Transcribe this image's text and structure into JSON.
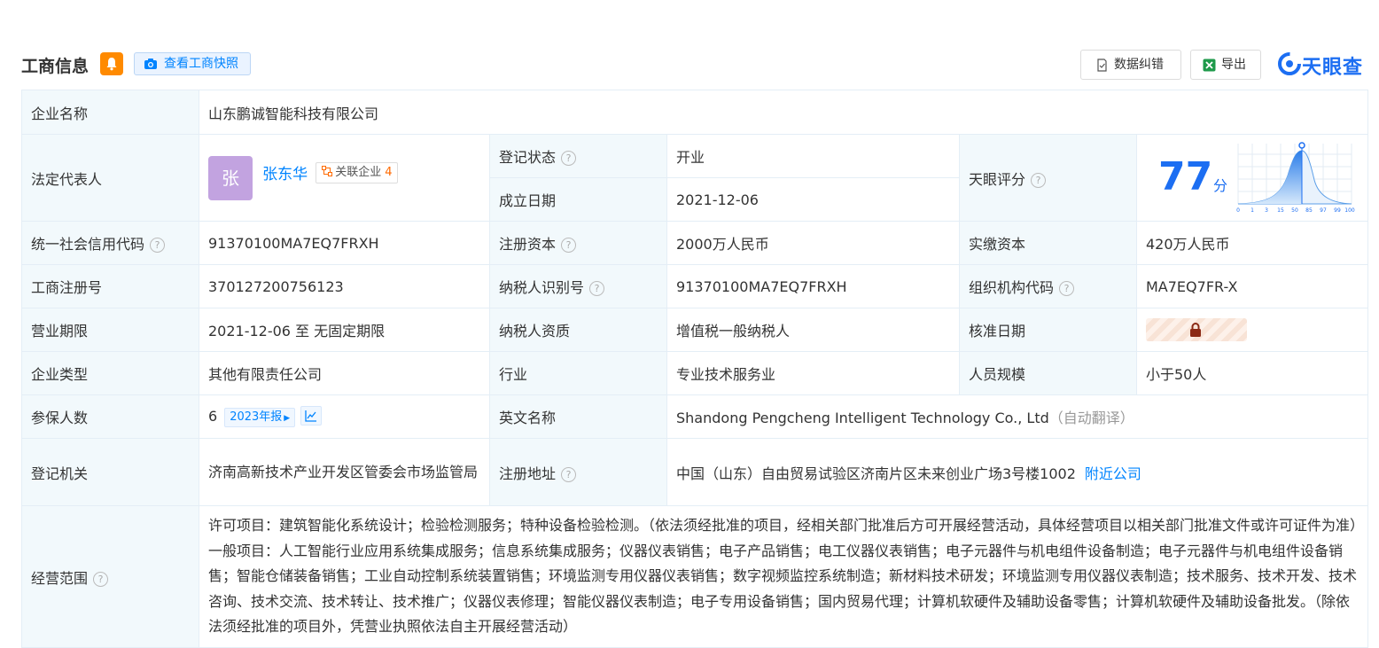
{
  "header": {
    "title": "工商信息",
    "snapshot_label": "查看工商快照",
    "error_label": "数据纠错",
    "export_label": "导出",
    "logo_text": "天眼查",
    "icons": [
      "bell-icon",
      "camera-icon",
      "document-check-icon",
      "excel-icon",
      "tianyancha-logo"
    ]
  },
  "rows": {
    "company_name": {
      "label": "企业名称",
      "value": "山东鹏诚智能科技有限公司"
    },
    "legal_rep": {
      "label": "法定代表人",
      "avatar": "张",
      "name": "张东华",
      "related_label": "关联企业",
      "related_count": "4"
    },
    "reg_status": {
      "label": "登记状态",
      "value": "开业"
    },
    "est_date": {
      "label": "成立日期",
      "value": "2021-12-06"
    },
    "tianyan_score": {
      "label": "天眼评分",
      "score": "77",
      "unit": "分",
      "chart_ticks": [
        "0",
        "1",
        "3",
        "15",
        "50",
        "85",
        "97",
        "99",
        "100"
      ]
    },
    "credit_code": {
      "label": "统一社会信用代码",
      "value": "91370100MA7EQ7FRXH"
    },
    "reg_capital": {
      "label": "注册资本",
      "value": "2000万人民币"
    },
    "paid_capital": {
      "label": "实缴资本",
      "value": "420万人民币"
    },
    "reg_number": {
      "label": "工商注册号",
      "value": "370127200756123"
    },
    "taxpayer_id": {
      "label": "纳税人识别号",
      "value": "91370100MA7EQ7FRXH"
    },
    "org_code": {
      "label": "组织机构代码",
      "value": "MA7EQ7FR-X"
    },
    "term": {
      "label": "营业期限",
      "value": "2021-12-06 至 无固定期限"
    },
    "taxpayer_qual": {
      "label": "纳税人资质",
      "value": "增值税一般纳税人"
    },
    "approve_date": {
      "label": "核准日期",
      "locked": true
    },
    "company_type": {
      "label": "企业类型",
      "value": "其他有限责任公司"
    },
    "industry": {
      "label": "行业",
      "value": "专业技术服务业"
    },
    "staff_size": {
      "label": "人员规模",
      "value": "小于50人"
    },
    "insured": {
      "label": "参保人数",
      "value": "6",
      "year_label": "2023年报"
    },
    "english_name": {
      "label": "英文名称",
      "value": "Shandong Pengcheng Intelligent Technology Co., Ltd",
      "note": "（自动翻译）"
    },
    "reg_authority": {
      "label": "登记机关",
      "value": "济南高新技术产业开发区管委会市场监管局"
    },
    "reg_address": {
      "label": "注册地址",
      "value": "中国（山东）自由贸易试验区济南片区未来创业广场3号楼1002",
      "link": "附近公司"
    },
    "biz_scope": {
      "label": "经营范围",
      "value": "许可项目：建筑智能化系统设计；检验检测服务；特种设备检验检测。（依法须经批准的项目，经相关部门批准后方可开展经营活动，具体经营项目以相关部门批准文件或许可证件为准）一般项目：人工智能行业应用系统集成服务；信息系统集成服务；仪器仪表销售；电子产品销售；电工仪器仪表销售；电子元器件与机电组件设备制造；电子元器件与机电组件设备销售；智能仓储装备销售；工业自动控制系统装置销售；环境监测专用仪器仪表销售；数字视频监控系统制造；新材料技术研发；环境监测专用仪器仪表制造；技术服务、技术开发、技术咨询、技术交流、技术转让、技术推广；仪器仪表修理；智能仪器仪表制造；电子专用设备销售；国内贸易代理；计算机软硬件及辅助设备零售；计算机软硬件及辅助设备批发。（除依法须经批准的项目外，凭营业执照依法自主开展经营活动）"
    }
  }
}
